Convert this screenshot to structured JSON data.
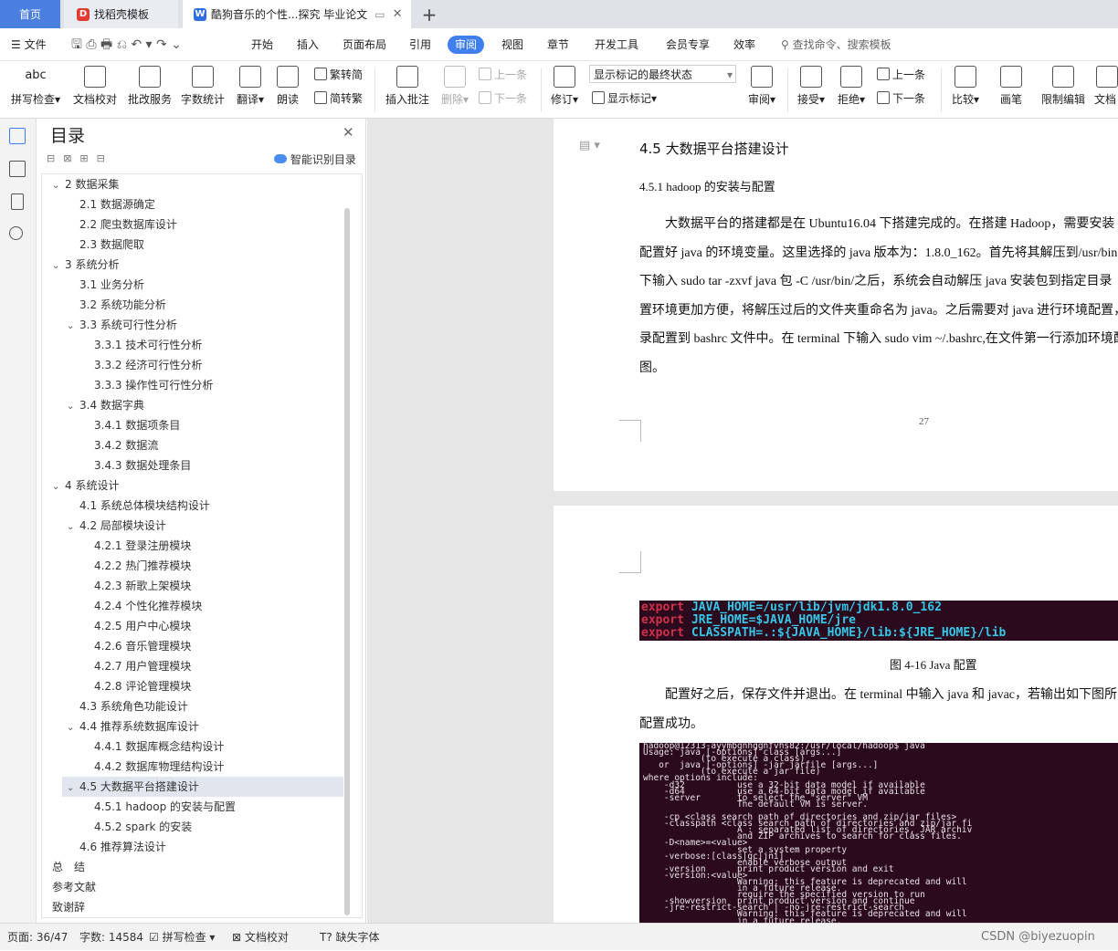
{
  "tabs": {
    "home": "首页",
    "template": "找稻壳模板",
    "document": "酷狗音乐的个性...探究 毕业论文",
    "new_tab": "+"
  },
  "menu": {
    "file": "文件",
    "items": [
      "开始",
      "插入",
      "页面布局",
      "引用",
      "审阅",
      "视图",
      "章节",
      "开发工具",
      "会员专享",
      "效率"
    ],
    "active": "审阅",
    "search": "查找命令、搜索模板"
  },
  "ribbon": {
    "spellcheck": "拼写检查",
    "proofread": "文档校对",
    "batch": "批改服务",
    "wordcount": "字数统计",
    "translate": "翻译",
    "read": "朗读",
    "trad": "繁转简",
    "simp": "简转繁",
    "insert_comment": "插入批注",
    "delete": "删除",
    "prev": "上一条",
    "next": "下一条",
    "revise": "修订",
    "markup_state": "显示标记的最终状态",
    "show_markup": "显示标记",
    "review": "审阅",
    "accept": "接受",
    "reject": "拒绝",
    "prev2": "上一条",
    "next2": "下一条",
    "compare": "比较",
    "ink": "画笔",
    "restrict": "限制编辑",
    "doc_more": "文档"
  },
  "toc": {
    "title": "目录",
    "smart": "智能识别目录",
    "items": [
      {
        "text": "2 数据采集",
        "level": 1,
        "caret": "v"
      },
      {
        "text": "2.1 数据源确定",
        "level": 2
      },
      {
        "text": "2.2 爬虫数据库设计",
        "level": 2
      },
      {
        "text": "2.3 数据爬取",
        "level": 2
      },
      {
        "text": "3 系统分析",
        "level": 1,
        "caret": "v"
      },
      {
        "text": "3.1 业务分析",
        "level": 2
      },
      {
        "text": "3.2 系统功能分析",
        "level": 2
      },
      {
        "text": "3.3  系统可行性分析",
        "level": 2,
        "caret": "v"
      },
      {
        "text": "3.3.1  技术可行性分析",
        "level": 3
      },
      {
        "text": "3.3.2  经济可行性分析",
        "level": 3
      },
      {
        "text": "3.3.3  操作性可行性分析",
        "level": 3
      },
      {
        "text": "3.4  数据字典",
        "level": 2,
        "caret": "v"
      },
      {
        "text": "3.4.1  数据项条目",
        "level": 3
      },
      {
        "text": "3.4.2  数据流",
        "level": 3
      },
      {
        "text": "3.4.3  数据处理条目",
        "level": 3
      },
      {
        "text": "4  系统设计",
        "level": 1,
        "caret": "v"
      },
      {
        "text": "4.1 系统总体模块结构设计",
        "level": 2
      },
      {
        "text": "4.2  局部模块设计",
        "level": 2,
        "caret": "v"
      },
      {
        "text": "4.2.1  登录注册模块",
        "level": 3
      },
      {
        "text": "4.2.2  热门推荐模块",
        "level": 3
      },
      {
        "text": "4.2.3  新歌上架模块",
        "level": 3
      },
      {
        "text": "4.2.4  个性化推荐模块",
        "level": 3
      },
      {
        "text": "4.2.5  用户中心模块",
        "level": 3
      },
      {
        "text": "4.2.6  音乐管理模块",
        "level": 3
      },
      {
        "text": "4.2.7  用户管理模块",
        "level": 3
      },
      {
        "text": "4.2.8  评论管理模块",
        "level": 3
      },
      {
        "text": "4.3  系统角色功能设计",
        "level": 2
      },
      {
        "text": "4.4  推荐系统数据库设计",
        "level": 2,
        "caret": "v"
      },
      {
        "text": "4.4.1  数据库概念结构设计",
        "level": 3
      },
      {
        "text": "4.4.2  数据库物理结构设计",
        "level": 3
      },
      {
        "text": "4.5  大数据平台搭建设计",
        "level": 2,
        "caret": "v"
      },
      {
        "text": "4.5.1 hadoop 的安装与配置",
        "level": 3
      },
      {
        "text": "4.5.2 spark 的安装",
        "level": 3
      },
      {
        "text": "4.6  推荐算法设计",
        "level": 2
      },
      {
        "text": "总　结",
        "level": 1
      },
      {
        "text": "参考文献",
        "level": 1
      },
      {
        "text": "致谢辞",
        "level": 1
      }
    ]
  },
  "doc": {
    "h2": "4.5  大数据平台搭建设计",
    "h3": "4.5.1 hadoop 的安装与配置",
    "para1": [
      "大数据平台的搭建都是在 Ubuntu16.04 下搭建完成的。在搭建 Hadoop，需要安装",
      "配置好 java 的环境变量。这里选择的 java 版本为：1.8.0_162。首先将其解压到/usr/bin",
      "下输入 sudo tar -zxvf java 包  -C /usr/bin/之后，系统会自动解压 java 安装包到指定目录",
      "置环境更加方便，将解压过后的文件夹重命名为 java。之后需要对 java 进行环境配置，",
      "录配置到 bashrc 文件中。在 terminal 下输入 sudo vim ~/.bashrc,在文件第一行添加环境配",
      "图。"
    ],
    "page_no": "27",
    "code": [
      {
        "kw": "export",
        "rest": "JAVA_HOME=/usr/lib/jvm/jdk1.8.0_162"
      },
      {
        "kw": "export",
        "rest": "JRE_HOME=$JAVA_HOME/jre"
      },
      {
        "kw": "export",
        "rest": "CLASSPATH=.:${JAVA_HOME}/lib:${JRE_HOME}/lib"
      }
    ],
    "caption": "图 4-16 Java 配置",
    "para2": [
      "配置好之后，保存文件并退出。在 terminal 中输入 java 和 javac，若输出如下图所",
      "配置成功。"
    ],
    "terminal_lines": [
      "hadoop@12313-ayymbgnhggnfvhs82:/usr/local/hadoop$ java",
      "Usage: java [-options] class [args...]",
      "           (to execute a class)",
      "   or  java [-options] -jar jarfile [args...]",
      "           (to execute a jar file)",
      "where options include:",
      "    -d32          use a 32-bit data model if available",
      "    -d64          use a 64-bit data model if available",
      "    -server       to select the \"server\" VM",
      "                  The default VM is server.",
      "",
      "    -cp <class search path of directories and zip/jar files>",
      "    -classpath <class search path of directories and zip/jar fi",
      "                  A : separated list of directories, JAR archiv",
      "                  and ZIP archives to search for class files.",
      "    -D<name>=<value>",
      "                  set a system property",
      "    -verbose:[class|gc|jni]",
      "                  enable verbose output",
      "    -version      print product version and exit",
      "    -version:<value>",
      "                  Warning: this feature is deprecated and will",
      "                  in a future release.",
      "                  require the specified version to run",
      "    -showversion  print product version and continue",
      "    -jre-restrict-search | -no-jre-restrict-search",
      "                  Warning: this feature is deprecated and will",
      "                  in a future release."
    ]
  },
  "status": {
    "page": "页面: 36/47",
    "words": "字数: 14584",
    "spell": "拼写检查",
    "proof": "文档校对",
    "font": "缺失字体",
    "watermark": "CSDN @biyezuopin"
  },
  "colors": {
    "accent": "#3f7ff0",
    "terminal_bg": "#2c0a1e",
    "terminal_kw": "#d0304a",
    "terminal_var": "#35c7e8"
  }
}
